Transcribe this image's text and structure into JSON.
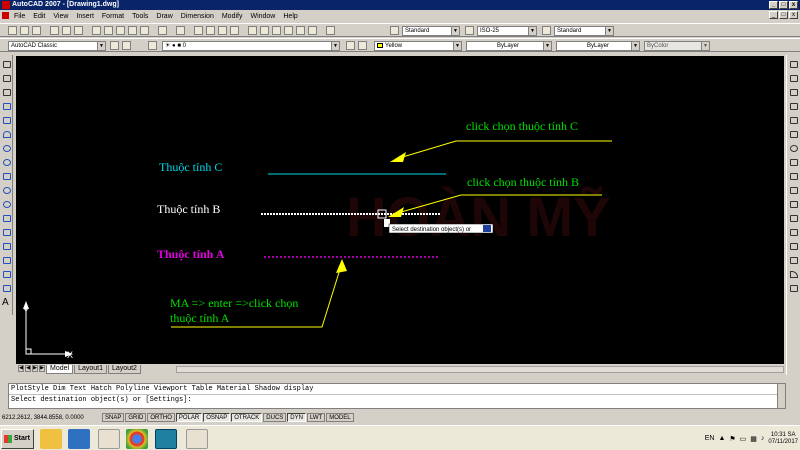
{
  "window": {
    "title": "AutoCAD 2007 - [Drawing1.dwg]",
    "controls": [
      "_",
      "□",
      "x"
    ]
  },
  "menu": [
    "File",
    "Edit",
    "View",
    "Insert",
    "Format",
    "Tools",
    "Draw",
    "Dimension",
    "Modify",
    "Window",
    "Help"
  ],
  "toolbar1": {
    "text_style": "Standard",
    "dim_style": "ISO-25",
    "table_style": "Standard"
  },
  "toolbar2": {
    "workspace": "AutoCAD Classic",
    "layer": "0",
    "color": "Yellow",
    "linetype": "ByLayer",
    "lineweight": "ByLayer",
    "plotstyle": "ByColor"
  },
  "drawing": {
    "label_c": "Thuộc tính C",
    "label_b": "Thuộc tính B",
    "label_a": "Thuộc tính A",
    "callout_c": "click chọn thuộc tính C",
    "callout_b": "click chọn thuộc tính B",
    "callout_ma_line1": "MA => enter =>click chọn",
    "callout_ma_line2": "thuộc tính A",
    "tooltip": "Select destination object(s) or",
    "watermark": "HOÀN MỸ",
    "ucs_x": "X",
    "ucs_y": "Y",
    "colors": {
      "cyan": "#00d8e8",
      "white": "#ffffff",
      "magenta": "#e000e0",
      "green": "#00e000",
      "yellow": "#ffff00"
    }
  },
  "tabs": [
    "Model",
    "Layout1",
    "Layout2"
  ],
  "command": {
    "line1": "PlotStyle Dim Text Hatch Polyline Viewport Table Material Shadow display",
    "line2": "Select destination object(s) or [Settings]:"
  },
  "status": {
    "coords": "6212.2612, 3844.8558, 0.0000",
    "buttons": [
      "SNAP",
      "GRID",
      "ORTHO",
      "POLAR",
      "OSNAP",
      "OTRACK",
      "DUCS",
      "DYN",
      "LWT",
      "MODEL"
    ]
  },
  "taskbar": {
    "start": "Start",
    "lang": "EN",
    "time": "10:31 SA",
    "date": "07/11/2017"
  }
}
